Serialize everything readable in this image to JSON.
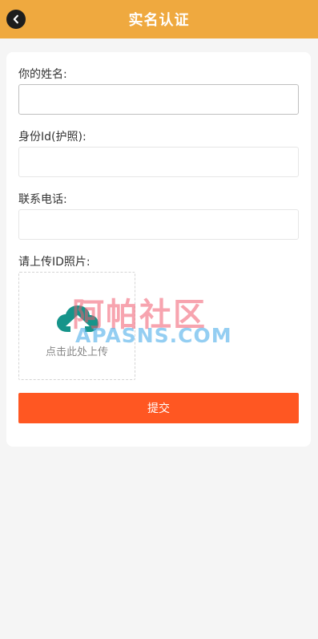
{
  "header": {
    "title": "实名认证",
    "back_icon": "chevron-left-icon"
  },
  "form": {
    "name_label": "你的姓名:",
    "name_value": "",
    "id_label": "身份Id(护照):",
    "id_value": "",
    "phone_label": "联系电话:",
    "phone_value": "",
    "photo_label": "请上传ID照片:",
    "upload_text": "点击此处上传",
    "upload_icon": "cloud-upload-icon",
    "submit_label": "提交"
  },
  "watermark": {
    "cn": "阿帕社区",
    "en": "APASNS.COM"
  },
  "colors": {
    "header": "#efa93f",
    "submit": "#ff5722",
    "upload_icon": "#16948a"
  }
}
